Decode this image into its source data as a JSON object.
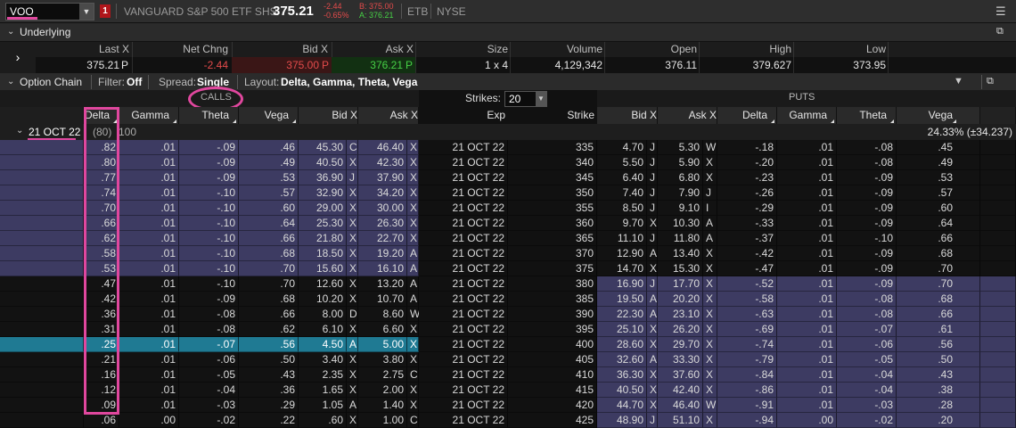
{
  "topbar": {
    "symbol": "VOO",
    "alert_count": "1",
    "description": "VANGUARD S&P 500 ETF SHS",
    "last": "375.21",
    "net_change": "-2.44",
    "pct_change": "-0.65%",
    "bid": "B: 375.00",
    "ask": "A: 376.21",
    "etb": "ETB",
    "exchange": "NYSE"
  },
  "underlying": {
    "title": "Underlying",
    "columns": [
      "Last X",
      "Net Chng",
      "Bid X",
      "Ask X",
      "Size",
      "Volume",
      "Open",
      "High",
      "Low"
    ],
    "values": {
      "last": "375.21",
      "last_x": "P",
      "net_chng": "-2.44",
      "bid": "375.00",
      "bid_x": "P",
      "ask": "376.21",
      "ask_x": "P",
      "size": "1 x 4",
      "volume": "4,129,342",
      "open": "376.11",
      "high": "379.627",
      "low": "373.95"
    }
  },
  "option_chain": {
    "title": "Option Chain",
    "filter_label": "Filter:",
    "filter_value": "Off",
    "spread_label": "Spread:",
    "spread_value": "Single",
    "layout_label": "Layout:",
    "layout_value": "Delta, Gamma, Theta, Vega"
  },
  "sections": {
    "calls": "CALLS",
    "puts": "PUTS",
    "strikes_label": "Strikes:",
    "strikes_value": "20"
  },
  "columns": {
    "calls": [
      "Delta",
      "Gamma",
      "Theta",
      "Vega",
      "Bid X",
      "Ask X"
    ],
    "mid": [
      "Exp",
      "Strike"
    ],
    "puts": [
      "Bid X",
      "Ask X",
      "Delta",
      "Gamma",
      "Theta",
      "Vega"
    ]
  },
  "expiration": {
    "label": "21 OCT 22",
    "count": "(80)",
    "multiplier": "100",
    "iv": "24.33% (±34.237)"
  },
  "rows": [
    {
      "c_delta": ".82",
      "c_gamma": ".01",
      "c_theta": "-.09",
      "c_vega": ".46",
      "c_bid": "45.30",
      "c_bx": "C",
      "c_ask": "46.40",
      "c_ax": "X",
      "exp": "21 OCT 22",
      "strike": "335",
      "p_bid": "4.70",
      "p_bx": "J",
      "p_ask": "5.30",
      "p_ax": "W",
      "p_delta": "-.18",
      "p_gamma": ".01",
      "p_theta": "-.08",
      "p_vega": ".45"
    },
    {
      "c_delta": ".80",
      "c_gamma": ".01",
      "c_theta": "-.09",
      "c_vega": ".49",
      "c_bid": "40.50",
      "c_bx": "X",
      "c_ask": "42.30",
      "c_ax": "X",
      "exp": "21 OCT 22",
      "strike": "340",
      "p_bid": "5.50",
      "p_bx": "J",
      "p_ask": "5.90",
      "p_ax": "X",
      "p_delta": "-.20",
      "p_gamma": ".01",
      "p_theta": "-.08",
      "p_vega": ".49"
    },
    {
      "c_delta": ".77",
      "c_gamma": ".01",
      "c_theta": "-.09",
      "c_vega": ".53",
      "c_bid": "36.90",
      "c_bx": "J",
      "c_ask": "37.90",
      "c_ax": "X",
      "exp": "21 OCT 22",
      "strike": "345",
      "p_bid": "6.40",
      "p_bx": "J",
      "p_ask": "6.80",
      "p_ax": "X",
      "p_delta": "-.23",
      "p_gamma": ".01",
      "p_theta": "-.09",
      "p_vega": ".53"
    },
    {
      "c_delta": ".74",
      "c_gamma": ".01",
      "c_theta": "-.10",
      "c_vega": ".57",
      "c_bid": "32.90",
      "c_bx": "X",
      "c_ask": "34.20",
      "c_ax": "X",
      "exp": "21 OCT 22",
      "strike": "350",
      "p_bid": "7.40",
      "p_bx": "J",
      "p_ask": "7.90",
      "p_ax": "J",
      "p_delta": "-.26",
      "p_gamma": ".01",
      "p_theta": "-.09",
      "p_vega": ".57"
    },
    {
      "c_delta": ".70",
      "c_gamma": ".01",
      "c_theta": "-.10",
      "c_vega": ".60",
      "c_bid": "29.00",
      "c_bx": "X",
      "c_ask": "30.00",
      "c_ax": "X",
      "exp": "21 OCT 22",
      "strike": "355",
      "p_bid": "8.50",
      "p_bx": "J",
      "p_ask": "9.10",
      "p_ax": "I",
      "p_delta": "-.29",
      "p_gamma": ".01",
      "p_theta": "-.09",
      "p_vega": ".60"
    },
    {
      "c_delta": ".66",
      "c_gamma": ".01",
      "c_theta": "-.10",
      "c_vega": ".64",
      "c_bid": "25.30",
      "c_bx": "X",
      "c_ask": "26.30",
      "c_ax": "X",
      "exp": "21 OCT 22",
      "strike": "360",
      "p_bid": "9.70",
      "p_bx": "X",
      "p_ask": "10.30",
      "p_ax": "A",
      "p_delta": "-.33",
      "p_gamma": ".01",
      "p_theta": "-.09",
      "p_vega": ".64"
    },
    {
      "c_delta": ".62",
      "c_gamma": ".01",
      "c_theta": "-.10",
      "c_vega": ".66",
      "c_bid": "21.80",
      "c_bx": "X",
      "c_ask": "22.70",
      "c_ax": "X",
      "exp": "21 OCT 22",
      "strike": "365",
      "p_bid": "11.10",
      "p_bx": "J",
      "p_ask": "11.80",
      "p_ax": "A",
      "p_delta": "-.37",
      "p_gamma": ".01",
      "p_theta": "-.10",
      "p_vega": ".66"
    },
    {
      "c_delta": ".58",
      "c_gamma": ".01",
      "c_theta": "-.10",
      "c_vega": ".68",
      "c_bid": "18.50",
      "c_bx": "X",
      "c_ask": "19.20",
      "c_ax": "A",
      "exp": "21 OCT 22",
      "strike": "370",
      "p_bid": "12.90",
      "p_bx": "A",
      "p_ask": "13.40",
      "p_ax": "X",
      "p_delta": "-.42",
      "p_gamma": ".01",
      "p_theta": "-.09",
      "p_vega": ".68"
    },
    {
      "c_delta": ".53",
      "c_gamma": ".01",
      "c_theta": "-.10",
      "c_vega": ".70",
      "c_bid": "15.60",
      "c_bx": "X",
      "c_ask": "16.10",
      "c_ax": "A",
      "exp": "21 OCT 22",
      "strike": "375",
      "p_bid": "14.70",
      "p_bx": "X",
      "p_ask": "15.30",
      "p_ax": "X",
      "p_delta": "-.47",
      "p_gamma": ".01",
      "p_theta": "-.09",
      "p_vega": ".70"
    },
    {
      "c_delta": ".47",
      "c_gamma": ".01",
      "c_theta": "-.10",
      "c_vega": ".70",
      "c_bid": "12.60",
      "c_bx": "X",
      "c_ask": "13.20",
      "c_ax": "A",
      "exp": "21 OCT 22",
      "strike": "380",
      "p_bid": "16.90",
      "p_bx": "J",
      "p_ask": "17.70",
      "p_ax": "X",
      "p_delta": "-.52",
      "p_gamma": ".01",
      "p_theta": "-.09",
      "p_vega": ".70"
    },
    {
      "c_delta": ".42",
      "c_gamma": ".01",
      "c_theta": "-.09",
      "c_vega": ".68",
      "c_bid": "10.20",
      "c_bx": "X",
      "c_ask": "10.70",
      "c_ax": "A",
      "exp": "21 OCT 22",
      "strike": "385",
      "p_bid": "19.50",
      "p_bx": "A",
      "p_ask": "20.20",
      "p_ax": "X",
      "p_delta": "-.58",
      "p_gamma": ".01",
      "p_theta": "-.08",
      "p_vega": ".68"
    },
    {
      "c_delta": ".36",
      "c_gamma": ".01",
      "c_theta": "-.08",
      "c_vega": ".66",
      "c_bid": "8.00",
      "c_bx": "D",
      "c_ask": "8.60",
      "c_ax": "W",
      "exp": "21 OCT 22",
      "strike": "390",
      "p_bid": "22.30",
      "p_bx": "A",
      "p_ask": "23.10",
      "p_ax": "X",
      "p_delta": "-.63",
      "p_gamma": ".01",
      "p_theta": "-.08",
      "p_vega": ".66"
    },
    {
      "c_delta": ".31",
      "c_gamma": ".01",
      "c_theta": "-.08",
      "c_vega": ".62",
      "c_bid": "6.10",
      "c_bx": "X",
      "c_ask": "6.60",
      "c_ax": "X",
      "exp": "21 OCT 22",
      "strike": "395",
      "p_bid": "25.10",
      "p_bx": "X",
      "p_ask": "26.20",
      "p_ax": "X",
      "p_delta": "-.69",
      "p_gamma": ".01",
      "p_theta": "-.07",
      "p_vega": ".61"
    },
    {
      "c_delta": ".25",
      "c_gamma": ".01",
      "c_theta": "-.07",
      "c_vega": ".56",
      "c_bid": "4.50",
      "c_bx": "A",
      "c_ask": "5.00",
      "c_ax": "X",
      "exp": "21 OCT 22",
      "strike": "400",
      "p_bid": "28.60",
      "p_bx": "X",
      "p_ask": "29.70",
      "p_ax": "X",
      "p_delta": "-.74",
      "p_gamma": ".01",
      "p_theta": "-.06",
      "p_vega": ".56"
    },
    {
      "c_delta": ".21",
      "c_gamma": ".01",
      "c_theta": "-.06",
      "c_vega": ".50",
      "c_bid": "3.40",
      "c_bx": "X",
      "c_ask": "3.80",
      "c_ax": "X",
      "exp": "21 OCT 22",
      "strike": "405",
      "p_bid": "32.60",
      "p_bx": "A",
      "p_ask": "33.30",
      "p_ax": "X",
      "p_delta": "-.79",
      "p_gamma": ".01",
      "p_theta": "-.05",
      "p_vega": ".50"
    },
    {
      "c_delta": ".16",
      "c_gamma": ".01",
      "c_theta": "-.05",
      "c_vega": ".43",
      "c_bid": "2.35",
      "c_bx": "X",
      "c_ask": "2.75",
      "c_ax": "C",
      "exp": "21 OCT 22",
      "strike": "410",
      "p_bid": "36.30",
      "p_bx": "X",
      "p_ask": "37.60",
      "p_ax": "X",
      "p_delta": "-.84",
      "p_gamma": ".01",
      "p_theta": "-.04",
      "p_vega": ".43"
    },
    {
      "c_delta": ".12",
      "c_gamma": ".01",
      "c_theta": "-.04",
      "c_vega": ".36",
      "c_bid": "1.65",
      "c_bx": "X",
      "c_ask": "2.00",
      "c_ax": "X",
      "exp": "21 OCT 22",
      "strike": "415",
      "p_bid": "40.50",
      "p_bx": "X",
      "p_ask": "42.40",
      "p_ax": "X",
      "p_delta": "-.86",
      "p_gamma": ".01",
      "p_theta": "-.04",
      "p_vega": ".38"
    },
    {
      "c_delta": ".09",
      "c_gamma": ".01",
      "c_theta": "-.03",
      "c_vega": ".29",
      "c_bid": "1.05",
      "c_bx": "A",
      "c_ask": "1.40",
      "c_ax": "X",
      "exp": "21 OCT 22",
      "strike": "420",
      "p_bid": "44.70",
      "p_bx": "X",
      "p_ask": "46.40",
      "p_ax": "W",
      "p_delta": "-.91",
      "p_gamma": ".01",
      "p_theta": "-.03",
      "p_vega": ".28"
    },
    {
      "c_delta": ".06",
      "c_gamma": ".00",
      "c_theta": "-.02",
      "c_vega": ".22",
      "c_bid": ".60",
      "c_bx": "X",
      "c_ask": "1.00",
      "c_ax": "C",
      "exp": "21 OCT 22",
      "strike": "425",
      "p_bid": "48.90",
      "p_bx": "J",
      "p_ask": "51.10",
      "p_ax": "X",
      "p_delta": "-.94",
      "p_gamma": ".00",
      "p_theta": "-.02",
      "p_vega": ".20"
    }
  ],
  "colors": {
    "itm": "#3d3b62",
    "otm": "#121212",
    "selected": "#1f7a93",
    "highlight": "#e0479e",
    "negative": "#e34b4b",
    "positive": "#46d146"
  }
}
